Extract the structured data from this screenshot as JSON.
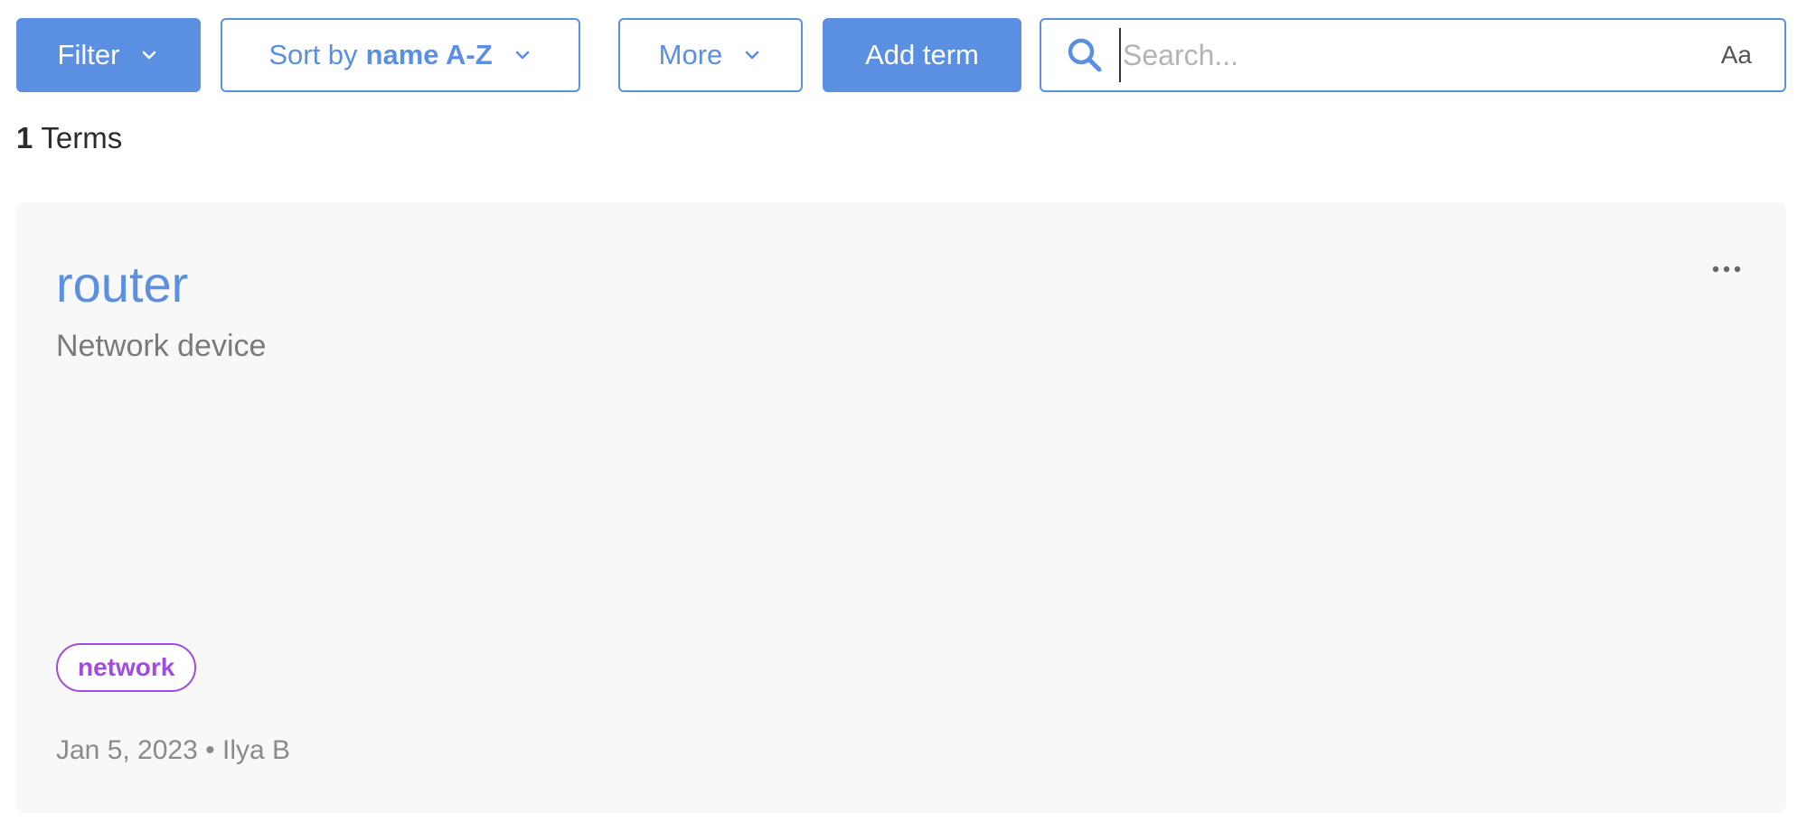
{
  "toolbar": {
    "filter_label": "Filter",
    "sort_prefix": "Sort by",
    "sort_value": "name A-Z",
    "more_label": "More",
    "add_label": "Add term"
  },
  "search": {
    "placeholder": "Search...",
    "value": "",
    "case_toggle_label": "Aa"
  },
  "results": {
    "count": "1",
    "count_label": "Terms"
  },
  "terms": [
    {
      "title": "router",
      "description": "Network device",
      "tag": "network",
      "date": "Jan 5, 2023",
      "separator": "•",
      "author": "Ilya B"
    }
  ],
  "colors": {
    "accent": "#5a8fe2",
    "tag": "#a24be3",
    "card_bg": "#f8f8f8"
  },
  "icons": {
    "search": "search-icon",
    "chevron": "chevron-down-icon",
    "more": "more-horizontal-icon"
  }
}
